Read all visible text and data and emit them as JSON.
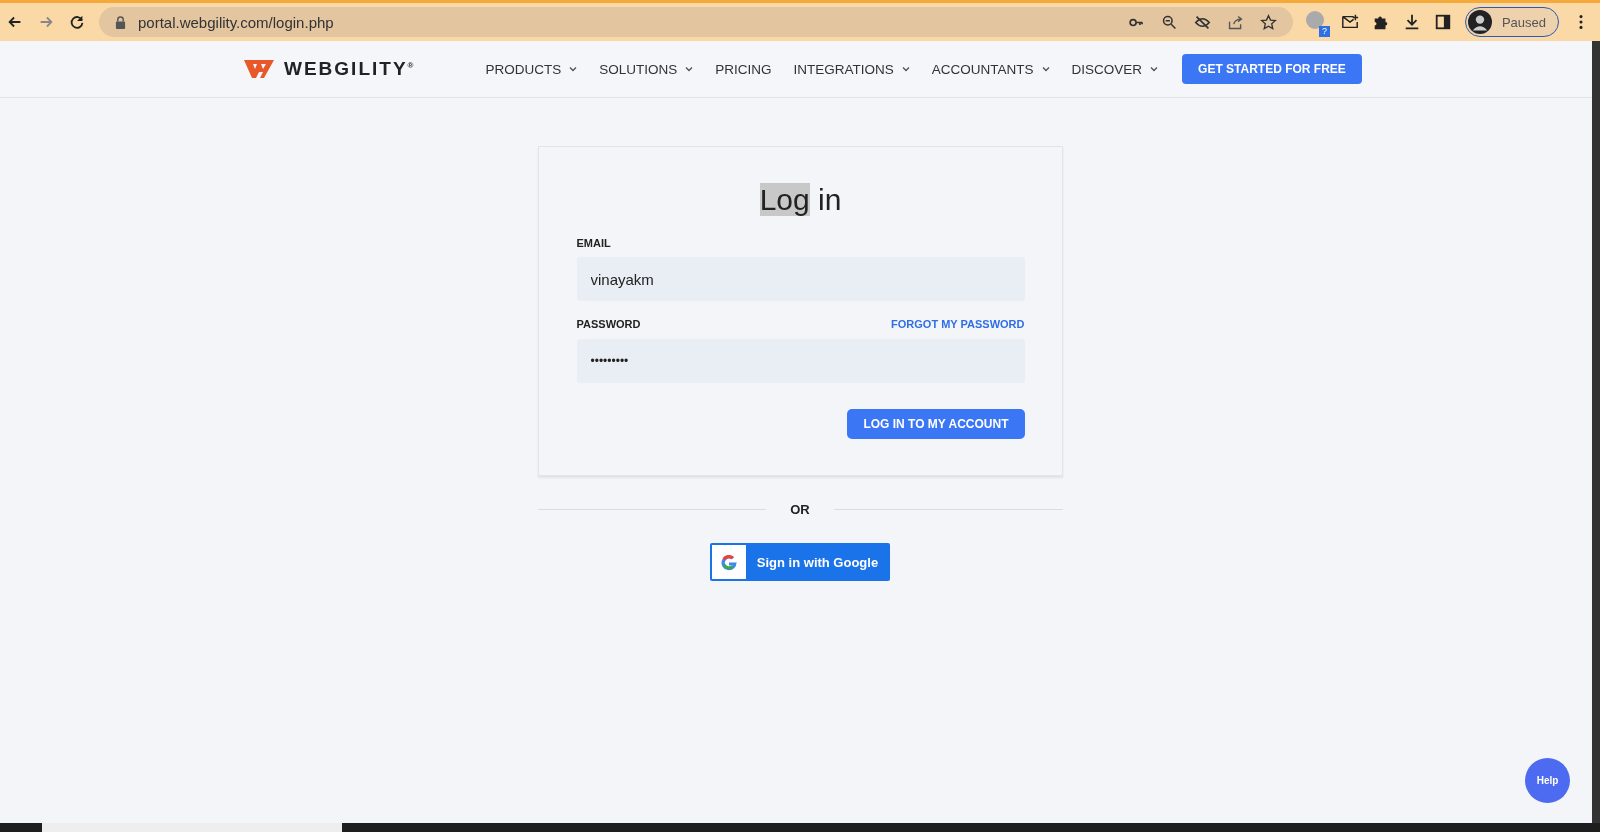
{
  "browser": {
    "url": "portal.webgility.com/login.php",
    "profile_status": "Paused",
    "extension_badge": "?"
  },
  "nav": {
    "brand": "WEBGILITY",
    "brand_mark": "®",
    "items": [
      {
        "label": "PRODUCTS",
        "dropdown": true
      },
      {
        "label": "SOLUTIONS",
        "dropdown": true
      },
      {
        "label": "PRICING",
        "dropdown": false
      },
      {
        "label": "INTEGRATIONS",
        "dropdown": true
      },
      {
        "label": "ACCOUNTANTS",
        "dropdown": true
      },
      {
        "label": "DISCOVER",
        "dropdown": true
      }
    ],
    "cta": "GET STARTED FOR FREE"
  },
  "login": {
    "title_highlighted": "Log",
    "title_rest": "in",
    "email": {
      "label": "EMAIL",
      "value": "vinayakm"
    },
    "password": {
      "label": "PASSWORD",
      "value": "•••••••••",
      "forgot_link": "FORGOT MY PASSWORD"
    },
    "submit": "LOG IN TO MY ACCOUNT"
  },
  "divider": "OR",
  "google_button": "Sign in with Google",
  "help_button": "Help"
}
